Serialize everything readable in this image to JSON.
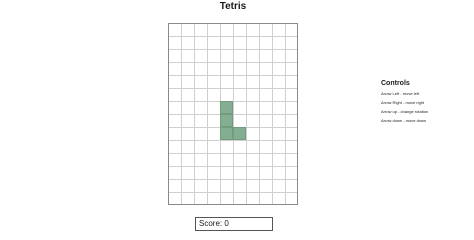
{
  "title": "Tetris",
  "board": {
    "columns": 10,
    "rows": 14,
    "piece": {
      "type": "L",
      "color": "#84ad91",
      "cells": [
        [
          4,
          6
        ],
        [
          4,
          7
        ],
        [
          4,
          8
        ],
        [
          5,
          8
        ]
      ]
    }
  },
  "score": {
    "label": "Score:",
    "value": "0"
  },
  "controls": {
    "title": "Controls",
    "items": [
      "Arrow Left - move left",
      "Arrow Right - move right",
      "Arrow up - change rotation",
      "Arrow down - move down"
    ]
  }
}
